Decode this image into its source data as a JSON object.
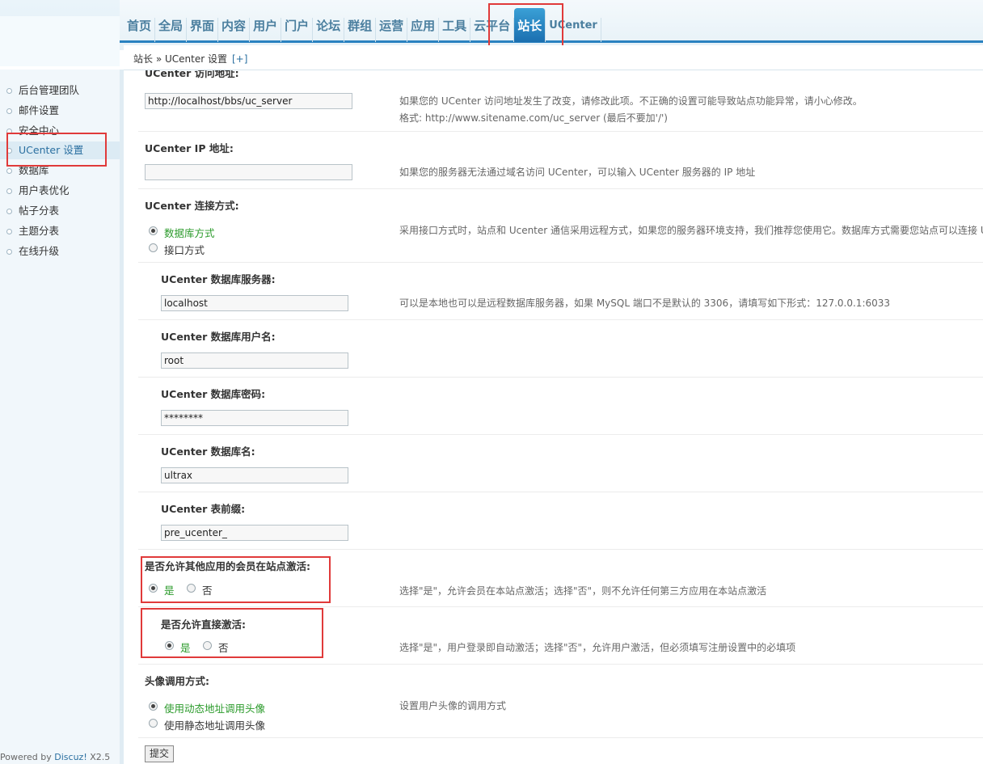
{
  "nav": {
    "items": [
      "首页",
      "全局",
      "界面",
      "内容",
      "用户",
      "门户",
      "论坛",
      "群组",
      "运营",
      "应用",
      "工具",
      "云平台",
      "站长",
      "UCenter"
    ],
    "active": "站长"
  },
  "breadcrumb": {
    "text": "站长 » UCenter 设置",
    "plus": "[+]"
  },
  "sidebar": {
    "items": [
      "后台管理团队",
      "邮件设置",
      "安全中心",
      "UCenter 设置",
      "数据库",
      "用户表优化",
      "帖子分表",
      "主题分表",
      "在线升级"
    ],
    "active": "UCenter 设置"
  },
  "powered": {
    "prefix": "Powered by ",
    "brand": "Discuz!",
    "version": " X2.5"
  },
  "form": {
    "uc_url": {
      "label": "UCenter 访问地址:",
      "value": "http://localhost/bbs/uc_server",
      "tip1": "如果您的 UCenter 访问地址发生了改变，请修改此项。不正确的设置可能导致站点功能异常，请小心修改。",
      "tip2": "格式: http://www.sitename.com/uc_server (最后不要加'/')"
    },
    "uc_ip": {
      "label": "UCenter IP 地址:",
      "value": "",
      "tip": "如果您的服务器无法通过域名访问 UCenter，可以输入 UCenter 服务器的 IP 地址"
    },
    "uc_connect": {
      "label": "UCenter 连接方式:",
      "opt1": "数据库方式",
      "opt2": "接口方式",
      "tip": "采用接口方式时，站点和 Ucenter 通信采用远程方式，如果您的服务器环境支持，我们推荐您使用它。数据库方式需要您站点可以连接 U"
    },
    "db_host": {
      "label": "UCenter 数据库服务器:",
      "value": "localhost",
      "tip": "可以是本地也可以是远程数据库服务器，如果 MySQL 端口不是默认的 3306，请填写如下形式：127.0.0.1:6033"
    },
    "db_user": {
      "label": "UCenter 数据库用户名:",
      "value": "root"
    },
    "db_pass": {
      "label": "UCenter 数据库密码:",
      "value": "********"
    },
    "db_name": {
      "label": "UCenter 数据库名:",
      "value": "ultrax"
    },
    "db_prefix": {
      "label": "UCenter 表前缀:",
      "value": "pre_ucenter_"
    },
    "activate_other": {
      "label": "是否允许其他应用的会员在站点激活:",
      "yes": "是",
      "no": "否",
      "tip": "选择\"是\"，允许会员在本站点激活；选择\"否\"，则不允许任何第三方应用在本站点激活"
    },
    "activate_direct": {
      "label": "是否允许直接激活:",
      "yes": "是",
      "no": "否",
      "tip": "选择\"是\"，用户登录即自动激活；选择\"否\"，允许用户激活，但必须填写注册设置中的必填项"
    },
    "avatar": {
      "label": "头像调用方式:",
      "opt1": "使用动态地址调用头像",
      "opt2": "使用静态地址调用头像",
      "tip": "设置用户头像的调用方式"
    },
    "submit": "提交"
  },
  "colors": {
    "nav_text": "#4b7f9f",
    "active_tab": "#2a82c0",
    "highlight_box": "#e03a3a",
    "selected_radio_text": "#2a9a2a"
  }
}
